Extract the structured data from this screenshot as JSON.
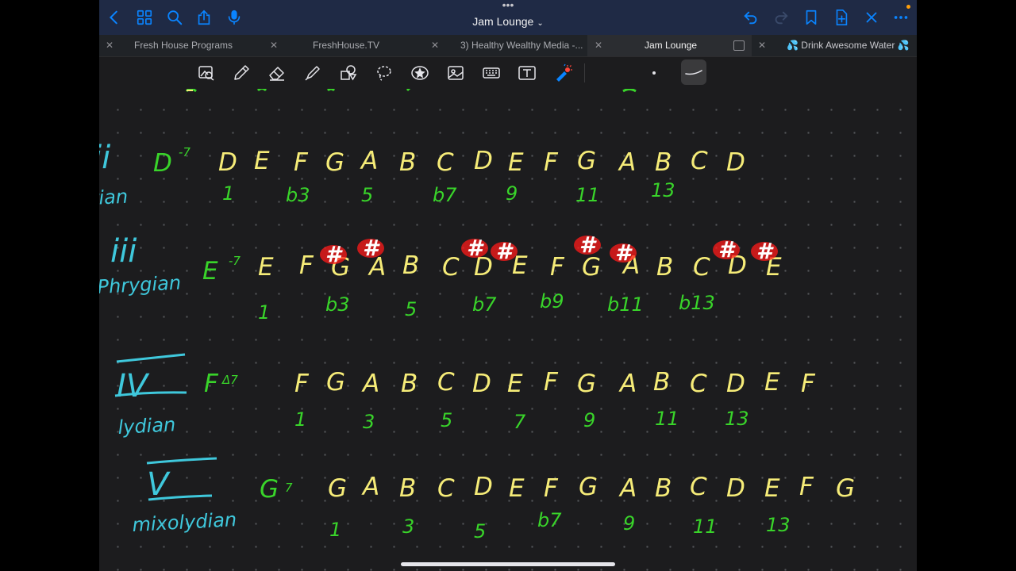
{
  "app": {
    "title": "Jam Lounge"
  },
  "tabs": [
    {
      "label": "Fresh House Programs",
      "active": false
    },
    {
      "label": "FreshHouse.TV",
      "active": false
    },
    {
      "label": "3) Healthy Wealthy Media -...",
      "active": false
    },
    {
      "label": "Jam Lounge",
      "active": true
    },
    {
      "label": "💦 Drink Awesome Water 💦",
      "active": false
    }
  ],
  "topbar_icons": {
    "left": [
      "back-chevron-icon",
      "grid-icon",
      "search-icon",
      "share-icon",
      "microphone-icon"
    ],
    "right": [
      "undo-icon",
      "redo-icon",
      "bookmark-icon",
      "add-page-icon",
      "close-icon",
      "more-icon"
    ]
  },
  "toolbar_tools": [
    "lasso-image-icon",
    "pen-icon",
    "eraser-icon",
    "highlighter-icon",
    "shapes-icon",
    "lasso-icon",
    "sticker-icon",
    "image-icon",
    "keyboard-icon",
    "text-icon",
    "laser-pointer-icon"
  ],
  "colors": {
    "notes": "#f6ec78",
    "intervals": "#39d42a",
    "labels": "#3fc8dc",
    "sharps": "#ff1a1a",
    "topbar": "#1f2a45",
    "accent": "#0a84ff"
  },
  "canvas": {
    "rows": [
      {
        "roman": "ii",
        "mode": "rian",
        "chord": "D",
        "chord_sup": "-7",
        "notes": [
          "D",
          "E",
          "F",
          "G",
          "A",
          "B",
          "C",
          "D",
          "E",
          "F",
          "G",
          "A",
          "B",
          "C",
          "D"
        ],
        "intervals": [
          "1",
          "b3",
          "5",
          "b7",
          "9",
          "11",
          "13"
        ]
      },
      {
        "roman": "iii",
        "mode": "Phrygian",
        "chord": "E",
        "chord_sup": "-7",
        "notes": [
          "E",
          "F",
          "G",
          "A",
          "B",
          "C",
          "D",
          "E",
          "F",
          "G",
          "A",
          "B",
          "C",
          "D",
          "E"
        ],
        "sharps": [
          "#",
          "#",
          "#",
          "#",
          "#",
          "#",
          "#",
          "#"
        ],
        "intervals": [
          "1",
          "b3",
          "5",
          "b7",
          "b9",
          "b11",
          "b13"
        ]
      },
      {
        "roman": "IV",
        "mode": "lydian",
        "chord": "F",
        "chord_sup": "Δ7",
        "notes": [
          "F",
          "G",
          "A",
          "B",
          "C",
          "D",
          "E",
          "F",
          "G",
          "A",
          "B",
          "C",
          "D",
          "E",
          "F"
        ],
        "intervals": [
          "1",
          "3",
          "5",
          "7",
          "9",
          "11",
          "13"
        ]
      },
      {
        "roman": "V",
        "mode": "mixolydian",
        "chord": "G",
        "chord_sup": "7",
        "notes": [
          "G",
          "A",
          "B",
          "C",
          "D",
          "E",
          "F",
          "G",
          "A",
          "B",
          "C",
          "D",
          "E",
          "F",
          "G"
        ],
        "intervals": [
          "1",
          "3",
          "5",
          "b7",
          "9",
          "11",
          "13"
        ]
      }
    ]
  }
}
